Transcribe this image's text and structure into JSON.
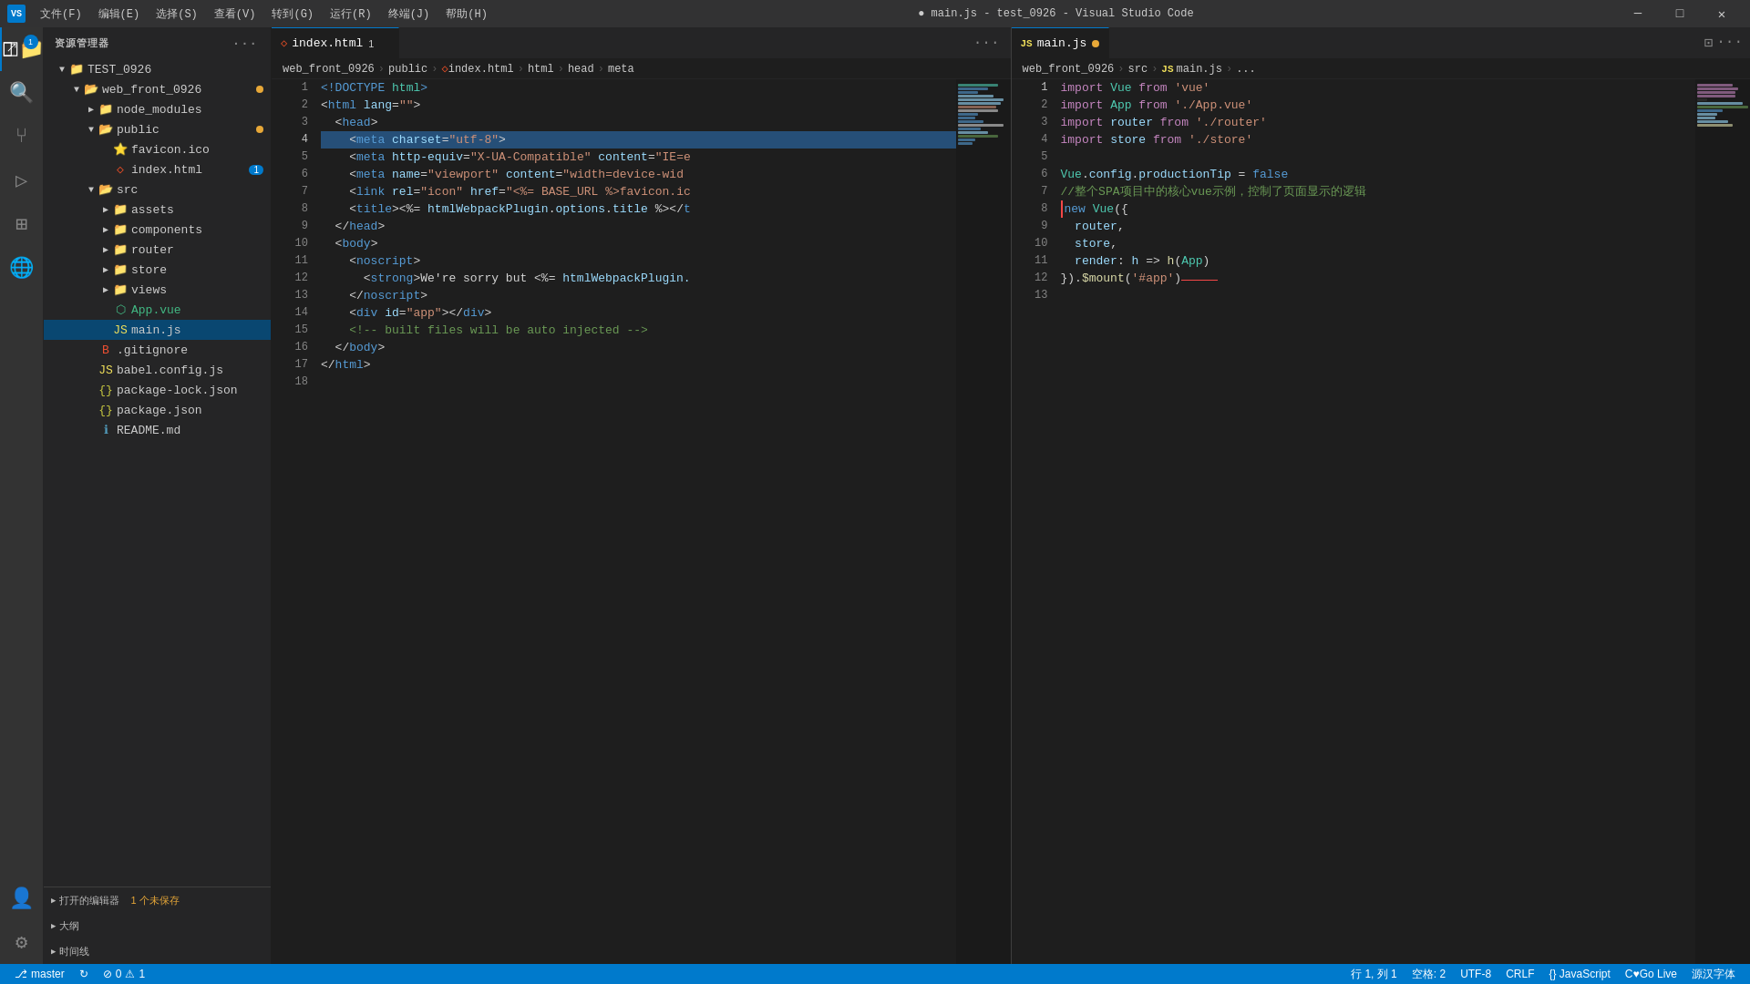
{
  "titlebar": {
    "icon": "VS",
    "menus": [
      "文件(F)",
      "编辑(E)",
      "选择(S)",
      "查看(V)",
      "转到(G)",
      "运行(R)",
      "终端(J)",
      "帮助(H)"
    ],
    "title": "● main.js - test_0926 - Visual Studio Code",
    "controls": [
      "🗕",
      "🗗",
      "✕"
    ]
  },
  "sidebar": {
    "title": "资源管理器",
    "overflow_icon": "···",
    "root": "TEST_0926",
    "tree": [
      {
        "id": "web_front_0926",
        "label": "web_front_0926",
        "type": "folder",
        "expanded": true,
        "indent": 1,
        "modified": true
      },
      {
        "id": "node_modules",
        "label": "node_modules",
        "type": "folder",
        "expanded": false,
        "indent": 2
      },
      {
        "id": "public",
        "label": "public",
        "type": "folder",
        "expanded": true,
        "indent": 2,
        "modified": true
      },
      {
        "id": "favicon.ico",
        "label": "favicon.ico",
        "type": "file-ico",
        "indent": 3
      },
      {
        "id": "index.html",
        "label": "index.html",
        "type": "file-html",
        "indent": 3,
        "badge": "1"
      },
      {
        "id": "src",
        "label": "src",
        "type": "folder",
        "expanded": true,
        "indent": 2
      },
      {
        "id": "assets",
        "label": "assets",
        "type": "folder",
        "expanded": false,
        "indent": 3
      },
      {
        "id": "components",
        "label": "components",
        "type": "folder",
        "expanded": false,
        "indent": 3
      },
      {
        "id": "router",
        "label": "router",
        "type": "folder",
        "expanded": false,
        "indent": 3
      },
      {
        "id": "store",
        "label": "store",
        "type": "folder",
        "expanded": false,
        "indent": 3
      },
      {
        "id": "views",
        "label": "views",
        "type": "folder",
        "expanded": false,
        "indent": 3
      },
      {
        "id": "App.vue",
        "label": "App.vue",
        "type": "file-vue",
        "indent": 3
      },
      {
        "id": "main.js",
        "label": "main.js",
        "type": "file-js",
        "indent": 3,
        "focused": true
      },
      {
        "id": "gitignore",
        "label": ".gitignore",
        "type": "file-git",
        "indent": 2
      },
      {
        "id": "babel.config.js",
        "label": "babel.config.js",
        "type": "file-js-yellow",
        "indent": 2
      },
      {
        "id": "package-lock.json",
        "label": "package-lock.json",
        "type": "file-json",
        "indent": 2
      },
      {
        "id": "package.json",
        "label": "package.json",
        "type": "file-json",
        "indent": 2
      },
      {
        "id": "README.md",
        "label": "README.md",
        "type": "file-md",
        "indent": 2
      }
    ],
    "bottom_sections": [
      {
        "label": "打开的编辑器",
        "extra": "1 个未保存"
      },
      {
        "label": "大纲"
      },
      {
        "label": "时间线"
      }
    ]
  },
  "editor_left": {
    "tab": {
      "label": "index.html",
      "num": "1",
      "active": true
    },
    "breadcrumb": [
      "web_front_0926",
      "public",
      "index.html",
      "html",
      "head",
      "meta"
    ],
    "lines": [
      {
        "n": 1,
        "content": "<!DOCTYPE html>"
      },
      {
        "n": 2,
        "content": "<html lang=\"\">"
      },
      {
        "n": 3,
        "content": "  <head>"
      },
      {
        "n": 4,
        "content": "    <meta charset=\"utf-8\">"
      },
      {
        "n": 5,
        "content": "    <meta http-equiv=\"X-UA-Compatible\" content=\"IE=e"
      },
      {
        "n": 6,
        "content": "    <meta name=\"viewport\" content=\"width=device-wid"
      },
      {
        "n": 7,
        "content": "    <link rel=\"icon\" href=\"<%= BASE_URL %>favicon.ic"
      },
      {
        "n": 8,
        "content": "    <title><%= htmlWebpackPlugin.options.title %></t"
      },
      {
        "n": 9,
        "content": "  </head>"
      },
      {
        "n": 10,
        "content": "  <body>"
      },
      {
        "n": 11,
        "content": "    <noscript>"
      },
      {
        "n": 12,
        "content": "      <strong>We're sorry but <%= htmlWebpackPlugin."
      },
      {
        "n": 13,
        "content": "    </noscript>"
      },
      {
        "n": 14,
        "content": "    <div id=\"app\"></div>"
      },
      {
        "n": 15,
        "content": "    <!-- built files will be auto injected -->"
      },
      {
        "n": 16,
        "content": "  </body>"
      },
      {
        "n": 17,
        "content": "</html>"
      },
      {
        "n": 18,
        "content": ""
      }
    ]
  },
  "editor_right": {
    "tab": {
      "label": "main.js",
      "modified": true
    },
    "breadcrumb": [
      "web_front_0926",
      "src",
      "main.js",
      "..."
    ],
    "lines": [
      {
        "n": 1,
        "parts": [
          {
            "t": "import",
            "c": "imp"
          },
          {
            "t": " ",
            "c": "plain"
          },
          {
            "t": "Vue",
            "c": "id"
          },
          {
            "t": " ",
            "c": "plain"
          },
          {
            "t": "from",
            "c": "from"
          },
          {
            "t": " ",
            "c": "plain"
          },
          {
            "t": "'vue'",
            "c": "str"
          }
        ]
      },
      {
        "n": 2,
        "parts": [
          {
            "t": "import",
            "c": "imp"
          },
          {
            "t": " ",
            "c": "plain"
          },
          {
            "t": "App",
            "c": "id"
          },
          {
            "t": " ",
            "c": "plain"
          },
          {
            "t": "from",
            "c": "from"
          },
          {
            "t": " ",
            "c": "plain"
          },
          {
            "t": "'./App.vue'",
            "c": "str"
          }
        ]
      },
      {
        "n": 3,
        "parts": [
          {
            "t": "import",
            "c": "imp"
          },
          {
            "t": " ",
            "c": "plain"
          },
          {
            "t": "router",
            "c": "var"
          },
          {
            "t": " ",
            "c": "plain"
          },
          {
            "t": "from",
            "c": "from"
          },
          {
            "t": " ",
            "c": "plain"
          },
          {
            "t": "'./router'",
            "c": "str"
          }
        ]
      },
      {
        "n": 4,
        "parts": [
          {
            "t": "import",
            "c": "imp"
          },
          {
            "t": " ",
            "c": "plain"
          },
          {
            "t": "store",
            "c": "var"
          },
          {
            "t": " ",
            "c": "plain"
          },
          {
            "t": "from",
            "c": "from"
          },
          {
            "t": " ",
            "c": "plain"
          },
          {
            "t": "'./store'",
            "c": "str"
          }
        ]
      },
      {
        "n": 5,
        "parts": [
          {
            "t": "",
            "c": "plain"
          }
        ]
      },
      {
        "n": 6,
        "parts": [
          {
            "t": "Vue",
            "c": "id"
          },
          {
            "t": ".",
            "c": "plain"
          },
          {
            "t": "config",
            "c": "var"
          },
          {
            "t": ".",
            "c": "plain"
          },
          {
            "t": "productionTip",
            "c": "var"
          },
          {
            "t": " = ",
            "c": "plain"
          },
          {
            "t": "false",
            "c": "blue"
          }
        ]
      },
      {
        "n": 7,
        "parts": [
          {
            "t": "//整个SPA项目中的核心vue示例，控制了页面显示的逻辑",
            "c": "cm"
          }
        ]
      },
      {
        "n": 8,
        "parts": [
          {
            "t": "new",
            "c": "kw2"
          },
          {
            "t": " ",
            "c": "plain"
          },
          {
            "t": "Vue",
            "c": "id"
          },
          {
            "t": "({",
            "c": "plain"
          }
        ],
        "highlighted": true
      },
      {
        "n": 9,
        "parts": [
          {
            "t": "  router",
            "c": "var"
          },
          {
            "t": ",",
            "c": "plain"
          }
        ]
      },
      {
        "n": 10,
        "parts": [
          {
            "t": "  store",
            "c": "var"
          },
          {
            "t": ",",
            "c": "plain"
          }
        ]
      },
      {
        "n": 11,
        "parts": [
          {
            "t": "  render",
            "c": "var"
          },
          {
            "t": ": ",
            "c": "plain"
          },
          {
            "t": "h",
            "c": "var"
          },
          {
            "t": " => ",
            "c": "plain"
          },
          {
            "t": "h",
            "c": "fn"
          },
          {
            "t": "(",
            "c": "plain"
          },
          {
            "t": "App",
            "c": "id"
          },
          {
            "t": ")",
            "c": "plain"
          }
        ]
      },
      {
        "n": 12,
        "parts": [
          {
            "t": "}).",
            "c": "plain"
          },
          {
            "t": "$mount",
            "c": "fn"
          },
          {
            "t": "(",
            "c": "plain"
          },
          {
            "t": "'#app'",
            "c": "str"
          },
          {
            "t": ")",
            "c": "plain"
          }
        ]
      },
      {
        "n": 13,
        "parts": [
          {
            "t": "",
            "c": "plain"
          }
        ]
      }
    ]
  },
  "statusbar": {
    "left": [
      {
        "icon": "⎇",
        "label": "master"
      },
      {
        "icon": "↻",
        "label": ""
      },
      {
        "icon": "⊘",
        "label": "0"
      },
      {
        "icon": "⚠",
        "label": "1"
      }
    ],
    "right": [
      {
        "label": "行 1, 列 1"
      },
      {
        "label": "空格: 2"
      },
      {
        "label": "UTF-8"
      },
      {
        "label": "CRLF"
      },
      {
        "label": "{} JavaScript"
      },
      {
        "label": "C♥Go Live"
      },
      {
        "label": "源汉字体"
      }
    ]
  }
}
